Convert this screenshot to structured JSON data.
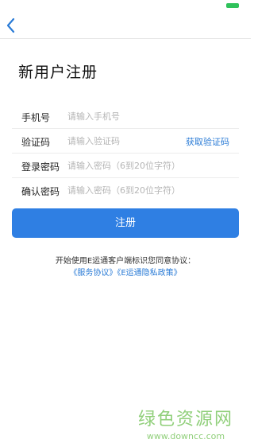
{
  "status_bar": {
    "battery_color": "#2fc25b"
  },
  "nav": {
    "back_icon": "chevron-left-icon"
  },
  "page": {
    "title": "新用户注册"
  },
  "form": {
    "rows": [
      {
        "label": "手机号",
        "placeholder": "请输入手机号",
        "value": ""
      },
      {
        "label": "验证码",
        "placeholder": "请输入验证码",
        "value": "",
        "action": "获取验证码"
      },
      {
        "label": "登录密码",
        "placeholder": "请输入密码（6到20位字符）",
        "value": ""
      },
      {
        "label": "确认密码",
        "placeholder": "请输入密码（6到20位字符）",
        "value": ""
      }
    ]
  },
  "register_button": {
    "label": "注册",
    "color": "#2f7fe3"
  },
  "agreement": {
    "text": "开始使用E运通客户端标识您同意协议：",
    "service_link": "《服务协议》",
    "privacy_link": "《E运通隐私政策》",
    "link_color": "#2a7bd6"
  },
  "watermark": {
    "logo": "绿色资源网",
    "url": "www.downcc.com"
  }
}
